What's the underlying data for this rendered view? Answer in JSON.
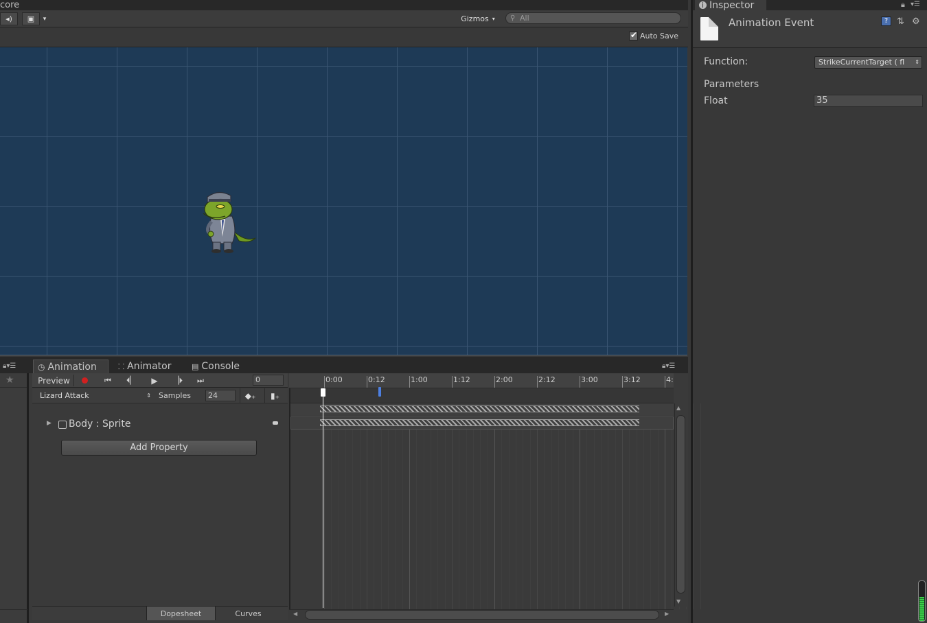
{
  "scene": {
    "title": "core",
    "gizmos_label": "Gizmos",
    "search_placeholder": "All",
    "autosave_label": "Auto Save"
  },
  "inspector": {
    "tab_label": "Inspector",
    "object_title": "Animation Event",
    "function_label": "Function:",
    "function_value": "StrikeCurrentTarget ( fl",
    "parameters_label": "Parameters",
    "float_label": "Float",
    "float_value": "35",
    "audio_meter_level": 0.6
  },
  "animation": {
    "tabs": [
      {
        "label": "Animation",
        "icon": "clock-icon"
      },
      {
        "label": "Animator",
        "icon": "animator-icon"
      },
      {
        "label": "Console",
        "icon": "console-icon"
      }
    ],
    "preview_label": "Preview",
    "frame_value": "0",
    "clip_name": "Lizard Attack",
    "samples_label": "Samples",
    "samples_value": "24",
    "property_label": "Body : Sprite",
    "add_property_label": "Add Property",
    "bottom_tabs": [
      "Dopesheet",
      "Curves"
    ],
    "ruler_labels": [
      "0:00",
      "0:12",
      "1:00",
      "1:12",
      "2:00",
      "2:12",
      "3:00",
      "3:12",
      "4:"
    ],
    "colors": {
      "viewport": "#1e3a56",
      "event_marker": "#4d7fe0",
      "record": "#d02020"
    }
  }
}
